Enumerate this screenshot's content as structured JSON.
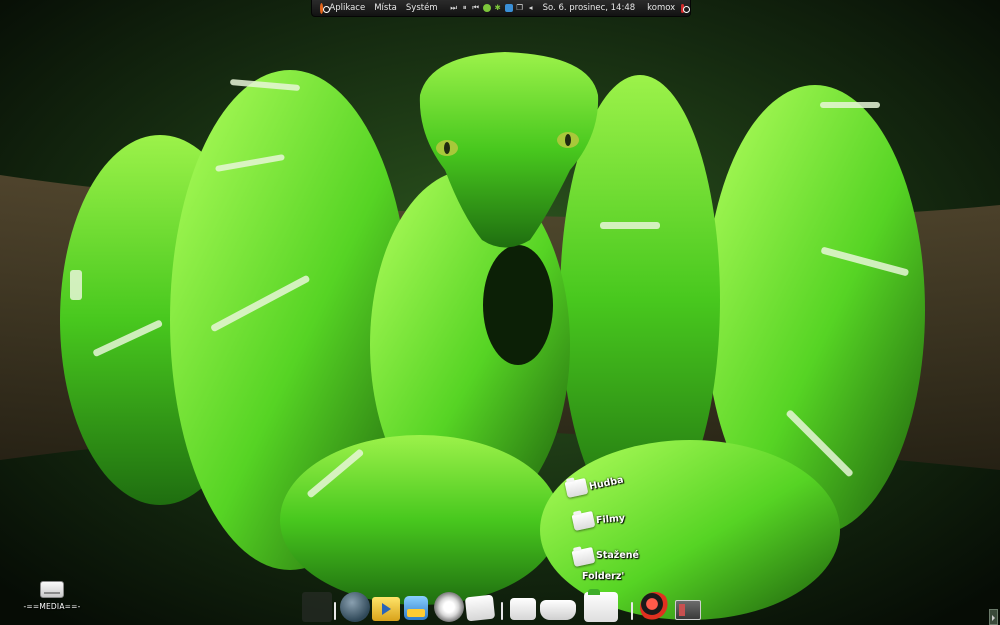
{
  "top_panel": {
    "menu": [
      "Aplikace",
      "Místa",
      "Systém"
    ],
    "clock": "So. 6. prosinec, 14:48",
    "user": "komox",
    "tray_icons": [
      "skip-next-icon",
      "pause-icon",
      "skip-previous-icon",
      "green-circle-icon",
      "gear-icon",
      "network-icon",
      "window-icon",
      "volume-icon"
    ]
  },
  "desktop": {
    "folders": [
      {
        "label": "Hudba"
      },
      {
        "label": "Filmy"
      },
      {
        "label": "Stažené"
      },
      {
        "label": "Folderz'"
      }
    ],
    "media_label": "-==MEDIA==-"
  },
  "colors": {
    "panel_bg": "#1c1c1c",
    "panel_text": "#e8e8e8",
    "ubuntu_orange": "#e4661c",
    "snake_green": "#5fd62a",
    "dark_green": "#0b1a0a"
  },
  "dock": {
    "items": [
      "window-icon",
      "globe-icon",
      "media-player-icon",
      "software-center-icon",
      "settings-icon",
      "folder-icon",
      "folder-icon",
      "drive-icon",
      "home-folder-icon",
      "debian-swirl-icon",
      "presentation-icon"
    ]
  }
}
